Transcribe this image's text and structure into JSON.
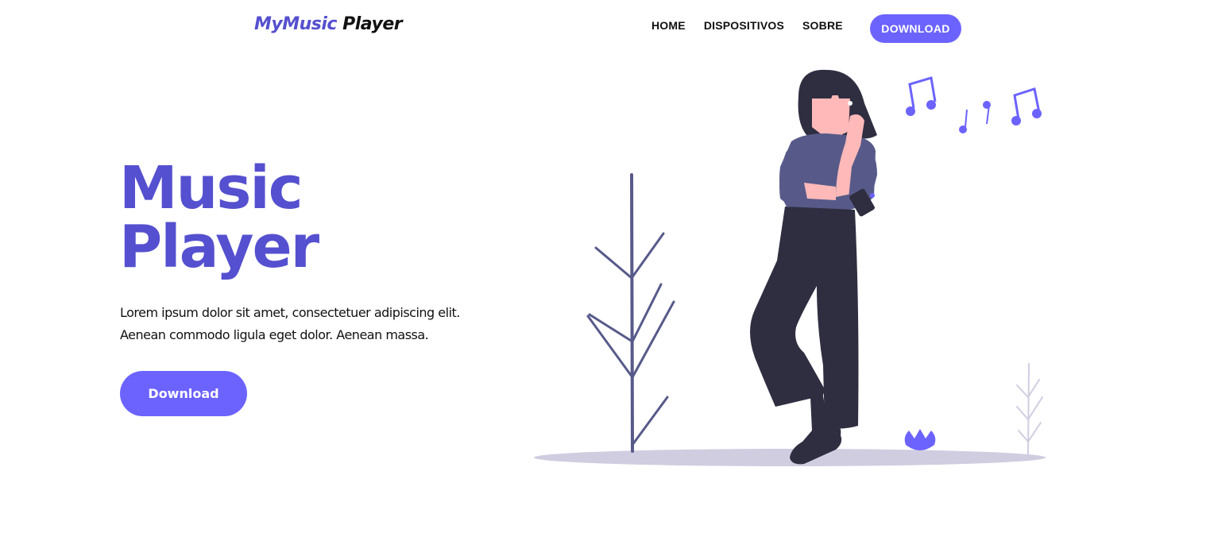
{
  "header": {
    "logo_brand": "MyMusic",
    "logo_suffix": "Player",
    "nav": [
      {
        "label": "HOME"
      },
      {
        "label": "DISPOSITIVOS"
      },
      {
        "label": "SOBRE"
      }
    ],
    "cta_label": "DOWNLOAD"
  },
  "hero": {
    "title_line1": "Music",
    "title_line2": "Player",
    "text_line1": "Lorem ipsum dolor sit amet, consectetuer adipiscing elit.",
    "text_line2": "Aenean commodo ligula eget dolor. Aenean massa.",
    "button_label": "Download"
  },
  "colors": {
    "accent": "#6c63ff",
    "heading": "#5550cf",
    "dark": "#2f2e41",
    "shirt": "#575a89",
    "skin": "#ffb9b9",
    "ground": "#d0cde1"
  },
  "illustration": {
    "icons": [
      "music-note-icon",
      "music-note-icon",
      "music-note-icon",
      "music-note-icon"
    ]
  }
}
